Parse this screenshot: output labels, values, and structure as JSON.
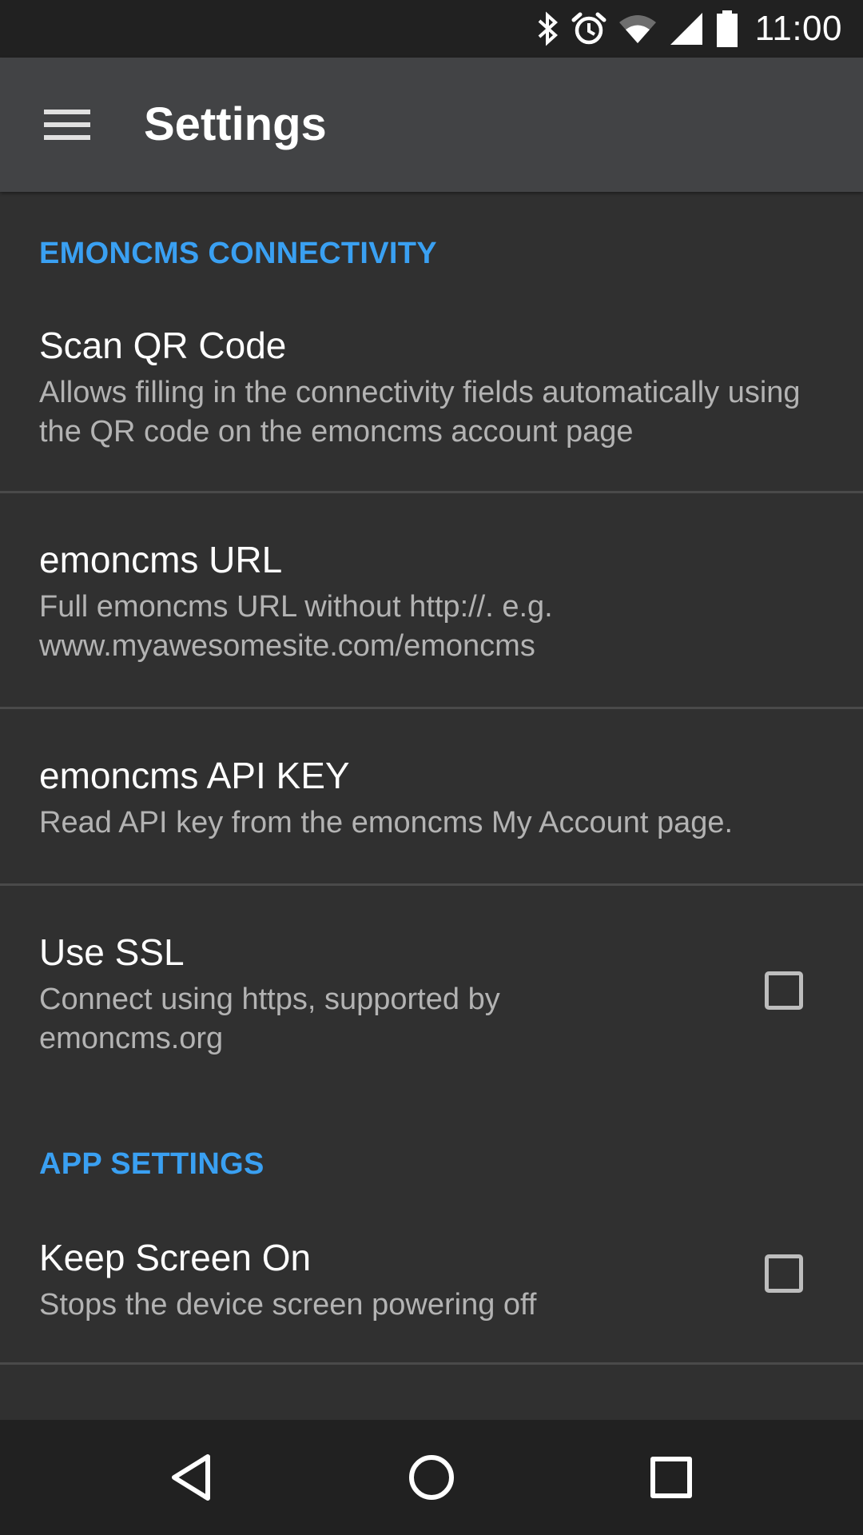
{
  "status_bar": {
    "time": "11:00",
    "icons": [
      "bluetooth-icon",
      "alarm-icon",
      "wifi-icon",
      "cell-signal-icon",
      "battery-icon"
    ]
  },
  "toolbar": {
    "title": "Settings",
    "menu_icon": "hamburger-menu-icon"
  },
  "sections": [
    {
      "header": "EMONCMS CONNECTIVITY",
      "items": [
        {
          "title": "Scan QR Code",
          "summary": "Allows filling in the connectivity fields automatically using the QR code on the emoncms account page"
        },
        {
          "title": "emoncms URL",
          "summary": "Full emoncms URL without http://. e.g. www.myawesomesite.com/emoncms"
        },
        {
          "title": "emoncms API KEY",
          "summary": "Read API key from the emoncms My Account page."
        },
        {
          "title": "Use SSL",
          "summary": "Connect using https, supported by emoncms.org",
          "checked": false
        }
      ]
    },
    {
      "header": "APP SETTINGS",
      "items": [
        {
          "title": "Keep Screen On",
          "summary": "Stops the device screen powering off",
          "checked": false
        }
      ]
    }
  ],
  "nav_bar": {
    "icons": [
      "back-icon",
      "home-icon",
      "recents-icon"
    ]
  },
  "colors": {
    "accent": "#3aa0f2",
    "background": "#303030",
    "toolbar": "#424345",
    "status_bar": "#212121"
  }
}
